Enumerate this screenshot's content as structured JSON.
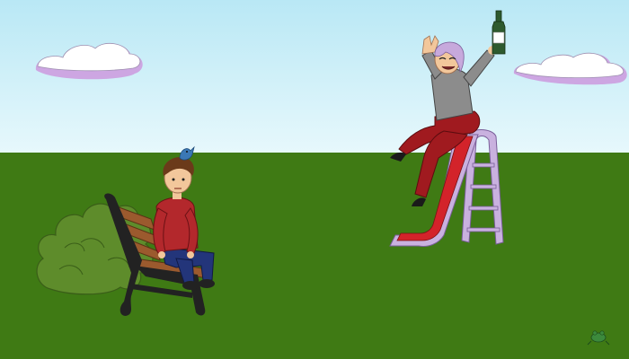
{
  "scene": {
    "colors": {
      "sky_top": "#b9e8f5",
      "sky_bottom": "#e7f8fc",
      "grass": "#3f7a14",
      "slide_frame": "#c9b1df",
      "slide_chute": "#d3232a",
      "bench_wood": "#9b5a2e",
      "bench_iron": "#222222",
      "bush": "#5e8c2b",
      "cloud_fill": "#ffffff",
      "cloud_shadow": "#cda6e2",
      "boy_shirt": "#b3282c",
      "boy_jeans": "#23357a",
      "woman_sweater": "#8c8c8c",
      "woman_pants": "#a01a1f",
      "woman_hair": "#c7a9dc",
      "bottle": "#2e5a2e"
    },
    "icons": [
      "cloud",
      "bush",
      "park-bench",
      "boy-figure",
      "bird",
      "playground-slide",
      "woman-figure",
      "wine-bottle",
      "frog"
    ]
  }
}
